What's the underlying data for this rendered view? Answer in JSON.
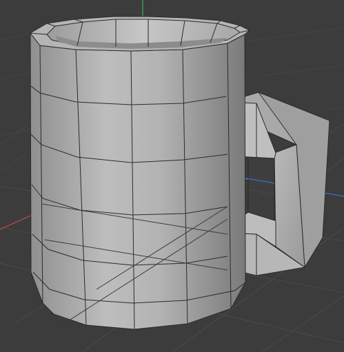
{
  "viewport": {
    "background": "#3c3c3c",
    "grid_color": "#4a4a4a",
    "axis_colors": {
      "x": "#c84a4a",
      "y": "#3fae4f",
      "z": "#3f6fc8"
    }
  },
  "object": {
    "kind": "mug",
    "shading": "flat-gray",
    "wireframe_overlay": true
  }
}
